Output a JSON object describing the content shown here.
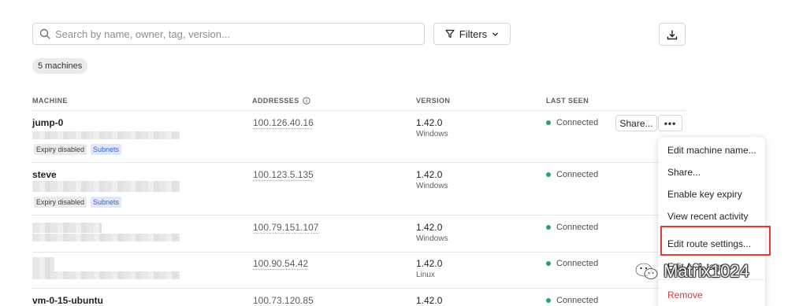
{
  "search": {
    "placeholder": "Search by name, owner, tag, version..."
  },
  "toolbar": {
    "filters_label": "Filters"
  },
  "machine_count": "5 machines",
  "columns": {
    "machine": "MACHINE",
    "addresses": "ADDRESSES",
    "version": "VERSION",
    "last_seen": "LAST SEEN"
  },
  "rows": [
    {
      "name": "jump-0",
      "address": "100.126.40.16",
      "version": "1.42.0",
      "os": "Windows",
      "status": "Connected",
      "tags": [
        "Expiry disabled",
        "Subnets"
      ]
    },
    {
      "name": "steve",
      "address": "100.123.5.135",
      "version": "1.42.0",
      "os": "Windows",
      "status": "Connected",
      "tags": [
        "Expiry disabled",
        "Subnets"
      ]
    },
    {
      "name": "",
      "address": "100.79.151.107",
      "version": "1.42.0",
      "os": "Windows",
      "status": "Connected",
      "tags": []
    },
    {
      "name": "",
      "address": "100.90.54.42",
      "version": "1.42.0",
      "os": "Linux",
      "status": "Connected",
      "tags": []
    },
    {
      "name": "vm-0-15-ubuntu",
      "address": "100.73.120.85",
      "version": "1.42.0",
      "os": "",
      "status": "Connected",
      "tags": []
    }
  ],
  "row_actions": {
    "share_label": "Share...",
    "more_label": "•••"
  },
  "menu": {
    "items": [
      "Edit machine name...",
      "Share...",
      "Enable key expiry",
      "View recent activity",
      "Edit route settings...",
      "Edit ACL tags...",
      "Remove"
    ]
  },
  "watermark": "Matrix1024",
  "colors": {
    "connected": "#2f9e6a",
    "danger": "#d93a3a",
    "highlight_box": "#e23b3b",
    "subnet_tag_bg": "#dfe8fb"
  },
  "icons": {
    "search": "search-icon",
    "filter": "filter-icon",
    "download": "download-icon",
    "info": "info-icon",
    "chevron": "chevron-down-icon",
    "wechat": "wechat-icon"
  }
}
